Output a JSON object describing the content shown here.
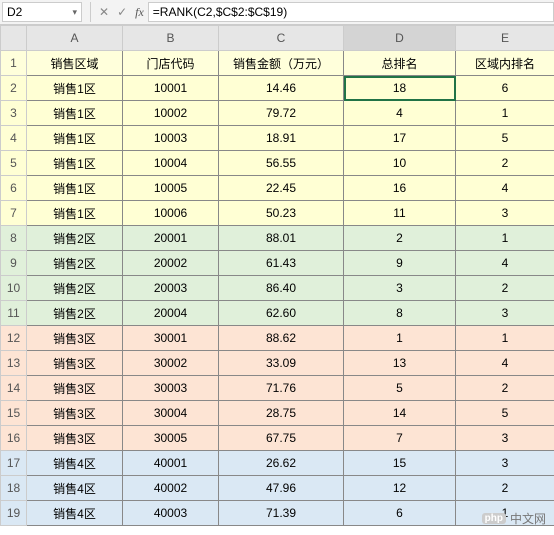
{
  "namebox": "D2",
  "formula": "=RANK(C2,$C$2:$C$19)",
  "columns": [
    "A",
    "B",
    "C",
    "D",
    "E"
  ],
  "header_row_num": "1",
  "headers": {
    "A": "销售区域",
    "B": "门店代码",
    "C": "销售金额（万元）",
    "D": "总排名",
    "E": "区域内排名"
  },
  "rows": [
    {
      "n": "2",
      "region": "region1",
      "A": "销售1区",
      "B": "10001",
      "C": "14.46",
      "D": "18",
      "E": "6",
      "sel": true
    },
    {
      "n": "3",
      "region": "region1",
      "A": "销售1区",
      "B": "10002",
      "C": "79.72",
      "D": "4",
      "E": "1"
    },
    {
      "n": "4",
      "region": "region1",
      "A": "销售1区",
      "B": "10003",
      "C": "18.91",
      "D": "17",
      "E": "5"
    },
    {
      "n": "5",
      "region": "region1",
      "A": "销售1区",
      "B": "10004",
      "C": "56.55",
      "D": "10",
      "E": "2"
    },
    {
      "n": "6",
      "region": "region1",
      "A": "销售1区",
      "B": "10005",
      "C": "22.45",
      "D": "16",
      "E": "4"
    },
    {
      "n": "7",
      "region": "region1",
      "A": "销售1区",
      "B": "10006",
      "C": "50.23",
      "D": "11",
      "E": "3"
    },
    {
      "n": "8",
      "region": "region2",
      "A": "销售2区",
      "B": "20001",
      "C": "88.01",
      "D": "2",
      "E": "1"
    },
    {
      "n": "9",
      "region": "region2",
      "A": "销售2区",
      "B": "20002",
      "C": "61.43",
      "D": "9",
      "E": "4"
    },
    {
      "n": "10",
      "region": "region2",
      "A": "销售2区",
      "B": "20003",
      "C": "86.40",
      "D": "3",
      "E": "2"
    },
    {
      "n": "11",
      "region": "region2",
      "A": "销售2区",
      "B": "20004",
      "C": "62.60",
      "D": "8",
      "E": "3"
    },
    {
      "n": "12",
      "region": "region3",
      "A": "销售3区",
      "B": "30001",
      "C": "88.62",
      "D": "1",
      "E": "1"
    },
    {
      "n": "13",
      "region": "region3",
      "A": "销售3区",
      "B": "30002",
      "C": "33.09",
      "D": "13",
      "E": "4"
    },
    {
      "n": "14",
      "region": "region3",
      "A": "销售3区",
      "B": "30003",
      "C": "71.76",
      "D": "5",
      "E": "2"
    },
    {
      "n": "15",
      "region": "region3",
      "A": "销售3区",
      "B": "30004",
      "C": "28.75",
      "D": "14",
      "E": "5"
    },
    {
      "n": "16",
      "region": "region3",
      "A": "销售3区",
      "B": "30005",
      "C": "67.75",
      "D": "7",
      "E": "3"
    },
    {
      "n": "17",
      "region": "region4",
      "A": "销售4区",
      "B": "40001",
      "C": "26.62",
      "D": "15",
      "E": "3"
    },
    {
      "n": "18",
      "region": "region4",
      "A": "销售4区",
      "B": "40002",
      "C": "47.96",
      "D": "12",
      "E": "2"
    },
    {
      "n": "19",
      "region": "region4",
      "A": "销售4区",
      "B": "40003",
      "C": "71.39",
      "D": "6",
      "E": "1"
    }
  ],
  "watermark": "中文网",
  "watermark_logo": "php"
}
